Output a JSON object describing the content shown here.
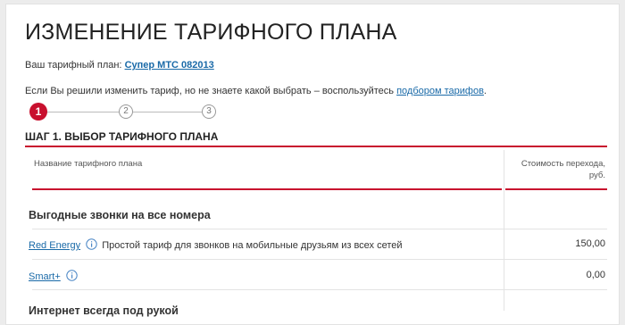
{
  "page": {
    "title": "ИЗМЕНЕНИЕ ТАРИФНОГО ПЛАНА",
    "current_plan_label": "Ваш тарифный план:",
    "current_plan_name": "Супер МТС 082013",
    "hint_text": "Если Вы решили изменить тариф, но не знаете какой выбрать – воспользуйтесь",
    "hint_link": "подбором тарифов",
    "hint_end": "."
  },
  "steps": [
    {
      "label": "1",
      "active": true
    },
    {
      "label": "2",
      "active": false
    },
    {
      "label": "3",
      "active": false
    }
  ],
  "step_heading": "ШАГ 1. ВЫБОР ТАРИФНОГО ПЛАНА",
  "table": {
    "col_name": "Название тарифного плана",
    "col_cost_line1": "Стоимость перехода,",
    "col_cost_line2": "руб.",
    "section_title": "Выгодные звонки на все номера",
    "rows": [
      {
        "name": "Red Energy",
        "description": "Простой тариф для звонков на мобильные друзьям из всех сетей",
        "price": "150,00"
      },
      {
        "name": "Smart+",
        "description": "",
        "price": "0,00"
      }
    ],
    "next_section_partial": "Интернет всегда под рукой"
  },
  "colors": {
    "accent": "#c8102e",
    "link": "#1a6aa8"
  },
  "icons": {
    "info": "info-icon"
  }
}
